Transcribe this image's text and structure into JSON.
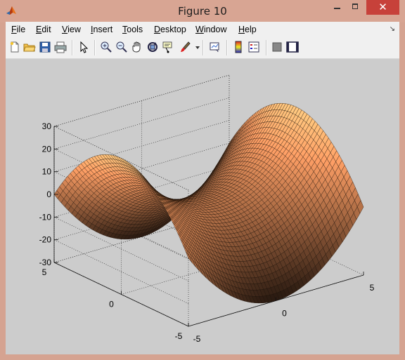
{
  "window": {
    "title": "Figure 10",
    "close_glyph": "✕"
  },
  "menu": {
    "file": {
      "u": "F",
      "rest": "ile"
    },
    "edit": {
      "u": "E",
      "rest": "dit"
    },
    "view": {
      "u": "V",
      "rest": "iew"
    },
    "insert": {
      "u": "I",
      "rest": "nsert"
    },
    "tools": {
      "u": "T",
      "rest": "ools"
    },
    "desktop": {
      "u": "D",
      "rest": "esktop"
    },
    "window": {
      "u": "W",
      "rest": "indow"
    },
    "help": {
      "u": "H",
      "rest": "elp"
    },
    "dock_glyph": "↘"
  },
  "toolbar": {
    "buttons": [
      "new-figure",
      "open-file",
      "save",
      "print",
      "edit-plot",
      "zoom-in",
      "zoom-out",
      "pan",
      "rotate-3d",
      "data-cursor",
      "brush",
      "link-plot",
      "insert-colorbar",
      "insert-legend",
      "hide-plot-tools",
      "show-plot-tools"
    ]
  },
  "chart_data": {
    "type": "surface",
    "function": "z = x^2 - y^2 (scaled saddle)",
    "xlim": [
      -5,
      5
    ],
    "ylim": [
      -5,
      5
    ],
    "zlim": [
      -30,
      30
    ],
    "z_ticks": [
      "30",
      "20",
      "10",
      "0",
      "-10",
      "-20",
      "-30"
    ],
    "x_ticks": [
      "-5",
      "0",
      "5"
    ],
    "y_ticks": [
      "-5",
      "0",
      "5"
    ],
    "colormap": "copper",
    "grid": true,
    "view": "3-D default (az -37.5, el 30)"
  }
}
